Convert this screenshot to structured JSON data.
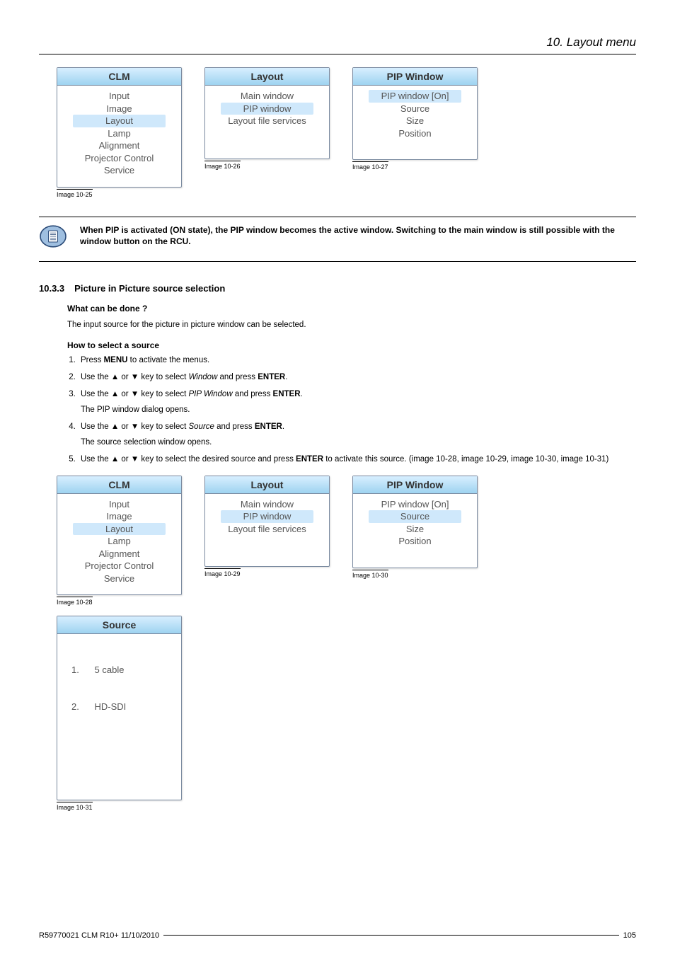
{
  "page_header": "10. Layout menu",
  "menus_top": {
    "clm": {
      "title": "CLM",
      "items": [
        "Input",
        "Image",
        "Layout",
        "Lamp",
        "Alignment",
        "Projector Control",
        "Service"
      ],
      "selected_index": 2,
      "caption": "Image 10-25"
    },
    "layout": {
      "title": "Layout",
      "items": [
        "Main window",
        "PIP window",
        "Layout file services"
      ],
      "selected_index": 1,
      "caption": "Image 10-26"
    },
    "pip": {
      "title": "PIP Window",
      "items": [
        "PIP window [On]",
        "Source",
        "Size",
        "Position"
      ],
      "selected_index": 0,
      "caption": "Image 10-27"
    }
  },
  "note_text": "When PIP is activated (ON state), the PIP window becomes the active window. Switching to the main window is still possible with the window button on the RCU.",
  "section": {
    "number": "10.3.3",
    "title": "Picture in Picture source selection",
    "what_heading": "What can be done ?",
    "what_text": "The input source for the picture in picture window can be selected.",
    "how_heading": "How to select a source",
    "steps": {
      "s1_a": "Press ",
      "s1_b": "MENU",
      "s1_c": " to activate the menus.",
      "s2_a": "Use the ▲ or ▼ key to select ",
      "s2_b": "Window",
      "s2_c": " and press ",
      "s2_d": "ENTER",
      "s2_e": ".",
      "s3_a": "Use the ▲ or ▼ key to select ",
      "s3_b": "PIP Window",
      "s3_c": " and press ",
      "s3_d": "ENTER",
      "s3_e": ".",
      "s3_sub": "The PIP window dialog opens.",
      "s4_a": "Use the ▲ or ▼ key to select ",
      "s4_b": "Source",
      "s4_c": " and press ",
      "s4_d": "ENTER",
      "s4_e": ".",
      "s4_sub": "The source selection window opens.",
      "s5_a": "Use the ▲ or ▼ key to select the desired source and press ",
      "s5_b": "ENTER",
      "s5_c": " to activate this source.  (image 10-28, image 10-29, image 10-30, image 10-31)"
    }
  },
  "menus_bottom": {
    "clm": {
      "title": "CLM",
      "items": [
        "Input",
        "Image",
        "Layout",
        "Lamp",
        "Alignment",
        "Projector Control",
        "Service"
      ],
      "selected_index": 2,
      "caption": "Image 10-28"
    },
    "layout": {
      "title": "Layout",
      "items": [
        "Main window",
        "PIP window",
        "Layout file services"
      ],
      "selected_index": 1,
      "caption": "Image 10-29"
    },
    "pip": {
      "title": "PIP Window",
      "items": [
        "PIP window [On]",
        "Source",
        "Size",
        "Position"
      ],
      "selected_index": 1,
      "caption": "Image 10-30"
    },
    "source": {
      "title": "Source",
      "items": [
        "1.      5 cable",
        "2.      HD-SDI"
      ],
      "selected_index": -1,
      "caption": "Image 10-31"
    }
  },
  "footer": {
    "left": "R59770021  CLM R10+  11/10/2010",
    "right": "105"
  }
}
